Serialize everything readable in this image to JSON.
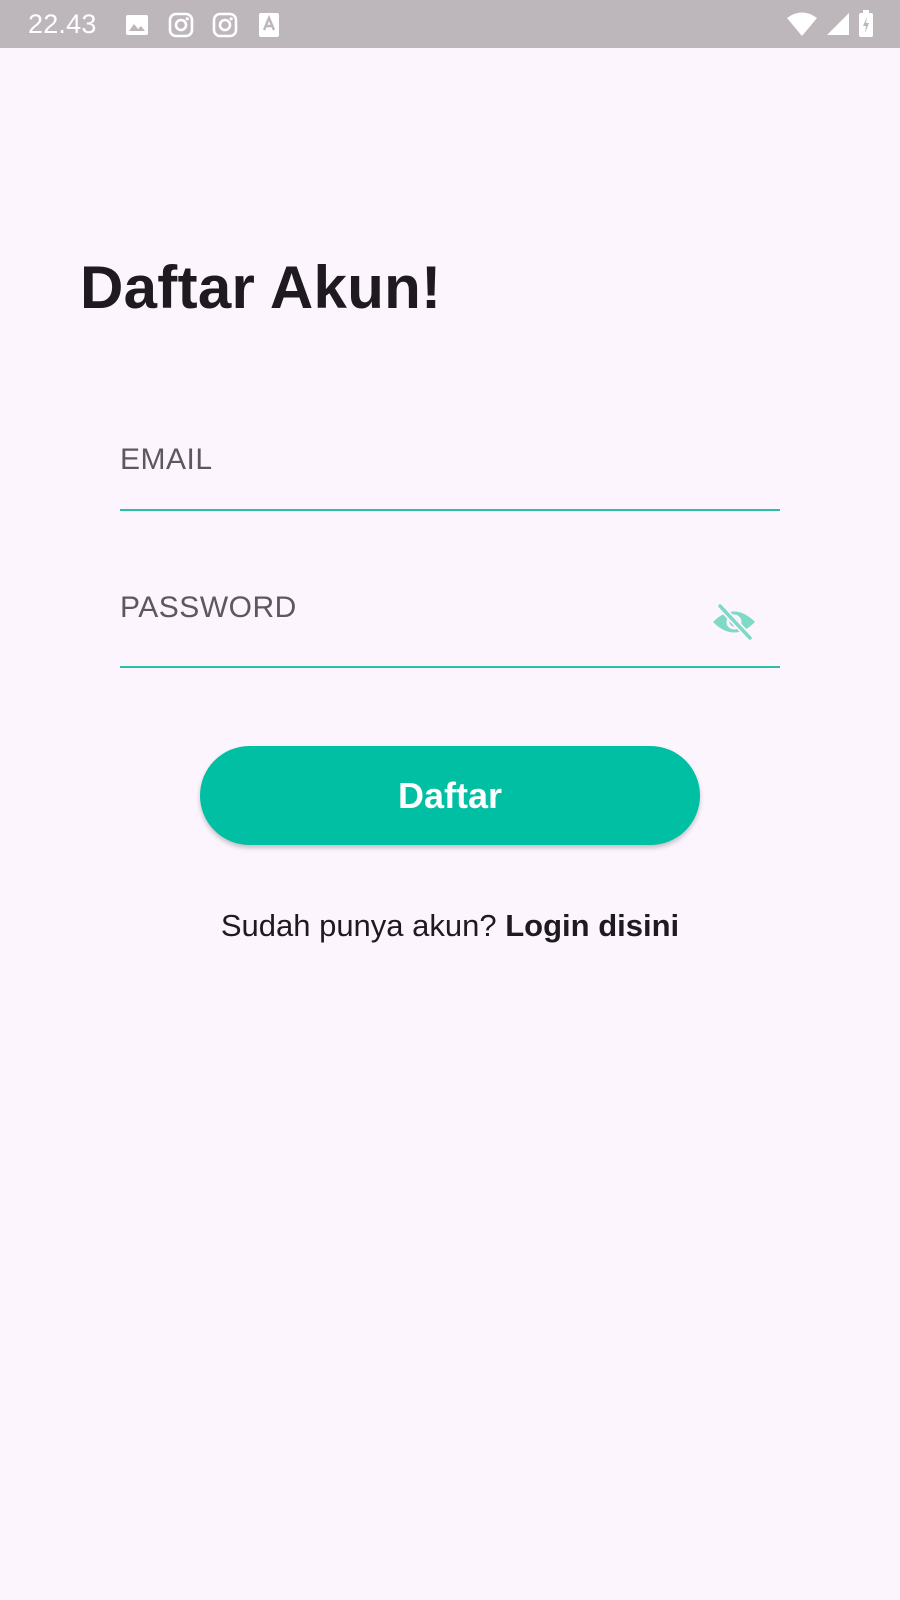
{
  "status_bar": {
    "time": "22.43",
    "left_icons": [
      "image-icon",
      "instagram-icon",
      "instagram-icon",
      "text-accessibility-icon"
    ],
    "right_icons": [
      "wifi-icon",
      "signal-icon",
      "battery-charging-icon"
    ]
  },
  "page": {
    "title": "Daftar Akun!"
  },
  "form": {
    "email_label": "EMAIL",
    "password_label": "PASSWORD",
    "password_toggle_icon": "visibility-off-icon",
    "submit_label": "Daftar"
  },
  "footer": {
    "prompt": "Sudah punya akun? ",
    "link": "Login disini"
  },
  "colors": {
    "background": "#fcf5fd",
    "accent": "#00bfa3",
    "underline": "#2bbfa5",
    "status_bar": "#bdb7bc",
    "text": "#1e1a20"
  }
}
